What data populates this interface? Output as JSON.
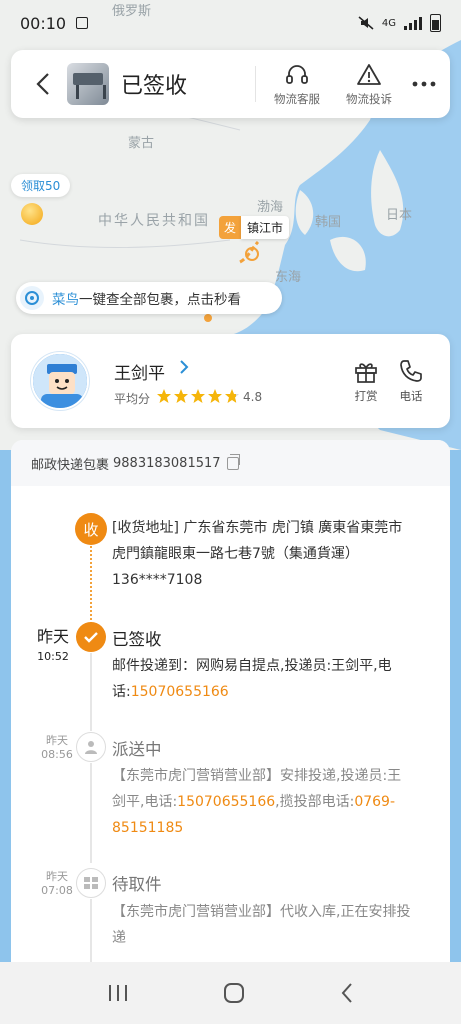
{
  "status_bar": {
    "time": "00:10",
    "network": "4G"
  },
  "header": {
    "title": "已签收",
    "service_label": "物流客服",
    "complaint_label": "物流投诉"
  },
  "map": {
    "labels": [
      "俄罗斯",
      "蒙古",
      "中华人民共和国",
      "日本",
      "韩国",
      "渤海",
      "东海"
    ],
    "coupon_label": "领取50",
    "origin_tag": "发",
    "origin_city": "镇江市"
  },
  "promo": {
    "brand": "菜鸟",
    "text": "一键查全部包裹，点击秒看"
  },
  "courier": {
    "name": "王剑平",
    "rating_label": "平均分",
    "rating": 4.8,
    "tip_label": "打赏",
    "phone_label": "电话"
  },
  "package": {
    "carrier": "邮政快递包裹",
    "tracking_no": "9883183081517"
  },
  "timeline": {
    "receive": {
      "badge": "收",
      "address": "[收货地址] 广东省东莞市  虎门镇   廣東省東莞市虎門鎮龍眼東一路七巷7號（集通貨運）",
      "phone": "136****7108"
    },
    "signed": {
      "date": "昨天",
      "time": "10:52",
      "status": "已签收",
      "desc": "邮件投递到：网购易自提点,投递员:王剑平,电话:",
      "phone": "15070655166"
    },
    "delivering": {
      "date": "昨天",
      "time": "08:56",
      "status": "派送中",
      "desc1": "【东莞市虎门营销营业部】安排投递,投递员:王剑平,电话:",
      "phone1": "15070655166",
      "desc2": ",揽投部电话:",
      "phone2": "0769-85151185"
    },
    "pickup": {
      "date": "昨天",
      "time": "07:08",
      "status": "待取件",
      "desc": "【东莞市虎门营销营业部】代收入库,正在安排投递"
    }
  },
  "colors": {
    "accent": "#ef8a13",
    "brand_blue": "#2b8fd6",
    "star": "#f5b50a"
  }
}
